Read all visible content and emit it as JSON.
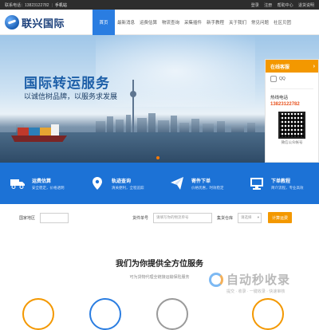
{
  "topbar": {
    "phone": "联系电话：13823122782",
    "mobile": "手机站",
    "links": [
      "登录",
      "注册",
      "帮助中心",
      "退货说明"
    ]
  },
  "header": {
    "logo_text": "联兴国际",
    "nav": [
      "首页",
      "最新消息",
      "运费估算",
      "物流查询",
      "采集插件",
      "新手教程",
      "关于我们",
      "常见问题",
      "社区贝团"
    ]
  },
  "hero": {
    "title": "国际转运服务",
    "subtitle": "以诚信树品牌，以服务求发展"
  },
  "online_panel": {
    "title": "在线客服",
    "qq_label": "QQ",
    "hotline_label": "热线电话",
    "hotline_number": "13823122782",
    "qr_caption": "微信公众帐号"
  },
  "services": [
    {
      "icon": "truck-icon",
      "title": "运费估算",
      "desc": "安全稳定，价格透明"
    },
    {
      "icon": "location-pin-icon",
      "title": "轨迹查询",
      "desc": "清关便利，全程追踪"
    },
    {
      "icon": "paper-plane-icon",
      "title": "寄件下单",
      "desc": "价格优惠，时效稳定"
    },
    {
      "icon": "monitor-icon",
      "title": "下单教程",
      "desc": "简介流程，专业高效"
    }
  ],
  "search": {
    "country_label": "国家地区",
    "tracking_label": "货件单号",
    "tracking_placeholder": "请填写你的物流单号",
    "warehouse_label": "集货仓库",
    "warehouse_value": "请选择",
    "button_label": "计算运费"
  },
  "section": {
    "title": "我们为你提供全方位服务",
    "subtitle": "可为货物代理全链接运输保险服务"
  },
  "watermark": {
    "name": "自动秒收录",
    "slogan": "提交 · 收录 · 一键收录 · 快速审核"
  },
  "colors": {
    "primary_blue": "#1c72d6",
    "nav_active": "#2a7de1",
    "accent_orange": "#f39800",
    "topbar_bg": "#2d2d2d"
  }
}
